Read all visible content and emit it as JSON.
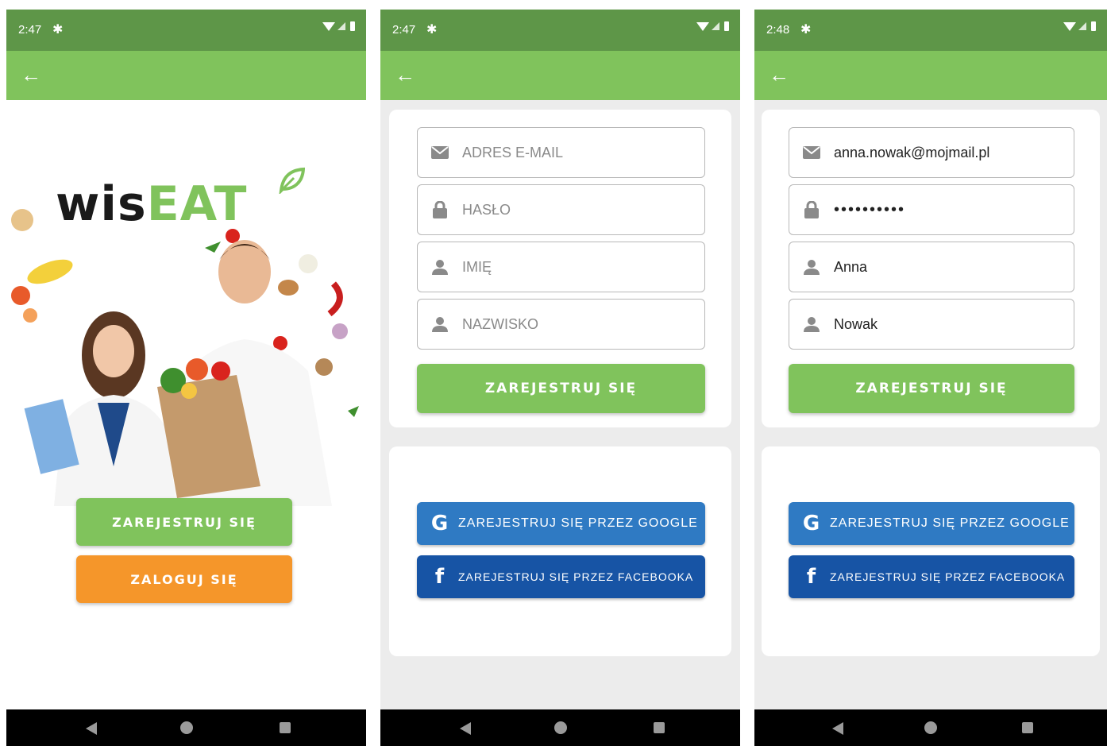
{
  "screen1": {
    "status": {
      "time": "2:47"
    },
    "logo": {
      "wis": "wis",
      "eat": "EAT"
    },
    "register_label": "ZAREJESTRUJ SIĘ",
    "login_label": "ZALOGUJ SIĘ"
  },
  "screen2": {
    "status": {
      "time": "2:47"
    },
    "email_placeholder": "ADRES E-MAIL",
    "password_placeholder": "HASŁO",
    "firstname_placeholder": "IMIĘ",
    "lastname_placeholder": "NAZWISKO",
    "submit_label": "ZAREJESTRUJ SIĘ",
    "google_label": "ZAREJESTRUJ SIĘ PRZEZ GOOGLE",
    "facebook_label": "ZAREJESTRUJ SIĘ PRZEZ FACEBOOKA"
  },
  "screen3": {
    "status": {
      "time": "2:48"
    },
    "email_value": "anna.nowak@mojmail.pl",
    "password_value": "••••••••••",
    "firstname_value": "Anna",
    "lastname_value": "Nowak",
    "submit_label": "ZAREJESTRUJ SIĘ",
    "google_label": "ZAREJESTRUJ SIĘ PRZEZ GOOGLE",
    "facebook_label": "ZAREJESTRUJ SIĘ PRZEZ FACEBOOKA"
  },
  "icons": {
    "status_gear": "gear-icon",
    "back": "arrow-left-icon",
    "email": "envelope-icon",
    "password": "lock-icon",
    "person": "person-icon",
    "google": "google-icon",
    "facebook": "facebook-icon"
  },
  "colors": {
    "status_bar": "#5e9648",
    "app_bar": "#80c35c",
    "primary_green": "#80c35c",
    "login_orange": "#f5962a",
    "google_blue": "#2f7ac3",
    "facebook_blue": "#1754a5"
  }
}
